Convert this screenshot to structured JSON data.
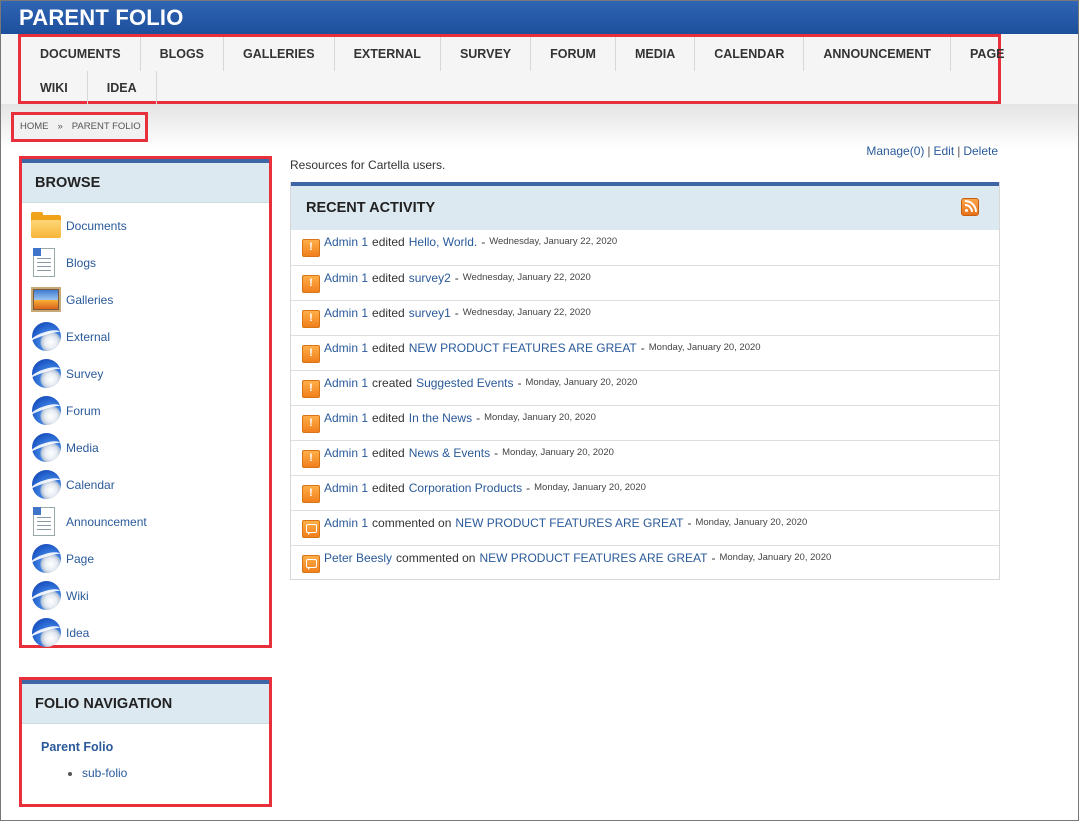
{
  "header": {
    "title": "PARENT FOLIO"
  },
  "topnav": {
    "row1": [
      "DOCUMENTS",
      "BLOGS",
      "GALLERIES",
      "EXTERNAL",
      "SURVEY",
      "FORUM",
      "MEDIA",
      "CALENDAR",
      "ANNOUNCEMENT",
      "PAGE"
    ],
    "row2": [
      "WIKI",
      "IDEA"
    ]
  },
  "breadcrumb": {
    "home": "HOME",
    "separator": "»",
    "current": "PARENT FOLIO"
  },
  "actions": {
    "manage": "Manage(0)",
    "sep": "|",
    "edit": "Edit",
    "delete": "Delete"
  },
  "browse": {
    "title": "BROWSE",
    "items": [
      {
        "label": "Documents",
        "icon": "folder-icon"
      },
      {
        "label": "Blogs",
        "icon": "document-icon"
      },
      {
        "label": "Galleries",
        "icon": "gallery-icon"
      },
      {
        "label": "External",
        "icon": "globe-icon"
      },
      {
        "label": "Survey",
        "icon": "globe-icon"
      },
      {
        "label": "Forum",
        "icon": "globe-icon"
      },
      {
        "label": "Media",
        "icon": "globe-icon"
      },
      {
        "label": "Calendar",
        "icon": "globe-icon"
      },
      {
        "label": "Announcement",
        "icon": "document-icon"
      },
      {
        "label": "Page",
        "icon": "globe-icon"
      },
      {
        "label": "Wiki",
        "icon": "globe-icon"
      },
      {
        "label": "Idea",
        "icon": "globe-icon"
      }
    ]
  },
  "folio_nav": {
    "title": "FOLIO NAVIGATION",
    "root": "Parent Folio",
    "children": [
      "sub-folio"
    ]
  },
  "description": "Resources for Cartella users.",
  "recent": {
    "title": "RECENT ACTIVITY",
    "rss_icon": "rss-icon",
    "accent": "#3e66a6",
    "items": [
      {
        "icon": "alert",
        "user": "Admin 1",
        "verb": "edited",
        "target": "Hello, World.",
        "date": "Wednesday, January 22, 2020"
      },
      {
        "icon": "alert",
        "user": "Admin 1",
        "verb": "edited",
        "target": "survey2",
        "date": "Wednesday, January 22, 2020"
      },
      {
        "icon": "alert",
        "user": "Admin 1",
        "verb": "edited",
        "target": "survey1",
        "date": "Wednesday, January 22, 2020"
      },
      {
        "icon": "alert",
        "user": "Admin 1",
        "verb": "edited",
        "target": "NEW PRODUCT FEATURES ARE GREAT",
        "date": "Monday, January 20, 2020"
      },
      {
        "icon": "alert",
        "user": "Admin 1",
        "verb": "created",
        "target": "Suggested Events",
        "date": "Monday, January 20, 2020"
      },
      {
        "icon": "alert",
        "user": "Admin 1",
        "verb": "edited",
        "target": "In the News",
        "date": "Monday, January 20, 2020"
      },
      {
        "icon": "alert",
        "user": "Admin 1",
        "verb": "edited",
        "target": "News & Events",
        "date": "Monday, January 20, 2020"
      },
      {
        "icon": "alert",
        "user": "Admin 1",
        "verb": "edited",
        "target": "Corporation Products",
        "date": "Monday, January 20, 2020"
      },
      {
        "icon": "comment",
        "user": "Admin 1",
        "verb": "commented on",
        "target": "NEW PRODUCT FEATURES ARE GREAT",
        "date": "Monday, January 20, 2020"
      },
      {
        "icon": "comment",
        "user": "Peter Beesly",
        "verb": "commented on",
        "target": "NEW PRODUCT FEATURES ARE GREAT",
        "date": "Monday, January 20, 2020"
      }
    ]
  }
}
